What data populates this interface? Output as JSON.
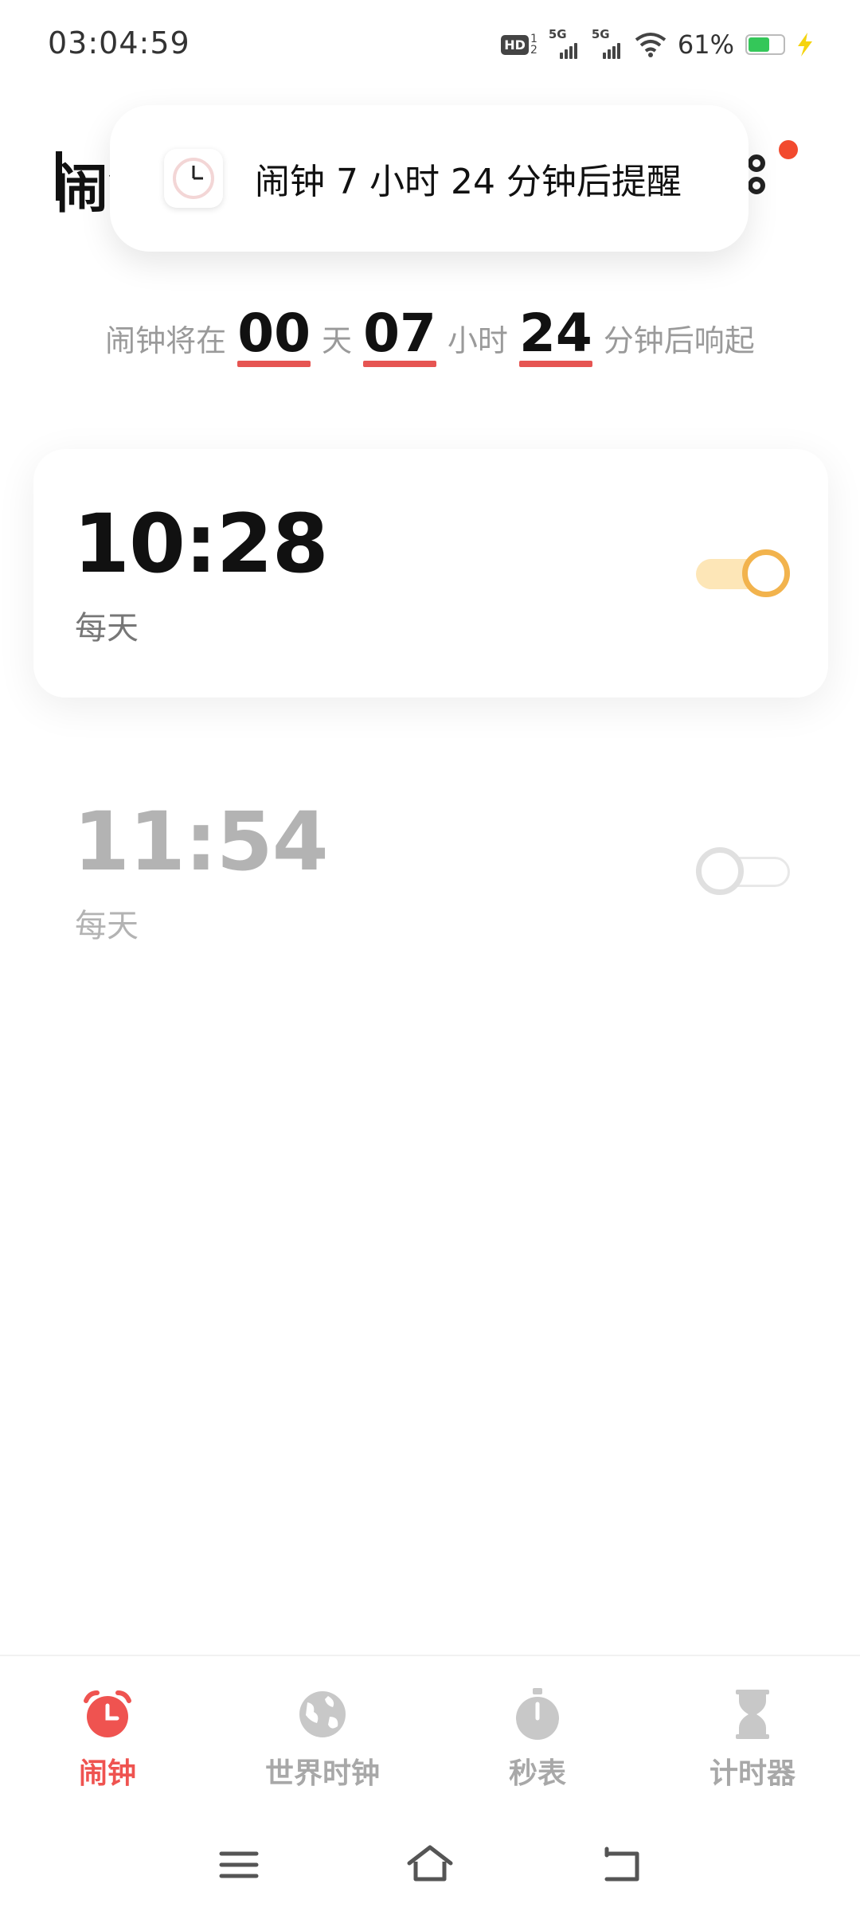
{
  "status_bar": {
    "time": "03:04:59",
    "hd_label": "HD",
    "hd_sub_top": "1",
    "hd_sub_bottom": "2",
    "sim1_label": "5G",
    "sim2_label": "5G",
    "battery_percent": "61%",
    "battery_level": 0.61,
    "icons": [
      "hd-icon",
      "signal-5g-icon",
      "signal-5g-icon",
      "wifi-icon",
      "battery-icon",
      "charging-icon"
    ]
  },
  "header": {
    "title": "闹钟",
    "menu_icon": "more-vertical-icon",
    "has_notification": true
  },
  "toast": {
    "icon": "clock-app-icon",
    "message": "闹钟 7 小时 24 分钟后提醒"
  },
  "countdown": {
    "prefix": "闹钟将在",
    "days": "00",
    "days_unit": "天",
    "hours": "07",
    "hours_unit": "小时",
    "minutes": "24",
    "minutes_unit": "分钟后响起"
  },
  "alarms": [
    {
      "time": "10:28",
      "repeat": "每天",
      "enabled": true
    },
    {
      "time": "11:54",
      "repeat": "每天",
      "enabled": false
    }
  ],
  "bottom_nav": {
    "items": [
      {
        "label": "闹钟",
        "icon": "alarm-icon",
        "active": true
      },
      {
        "label": "世界时钟",
        "icon": "globe-icon",
        "active": false
      },
      {
        "label": "秒表",
        "icon": "stopwatch-icon",
        "active": false
      },
      {
        "label": "计时器",
        "icon": "hourglass-icon",
        "active": false
      }
    ]
  },
  "colors": {
    "accent": "#ef5350",
    "toggle_on": "#f2b34d",
    "inactive_text": "#b3b3b3"
  }
}
